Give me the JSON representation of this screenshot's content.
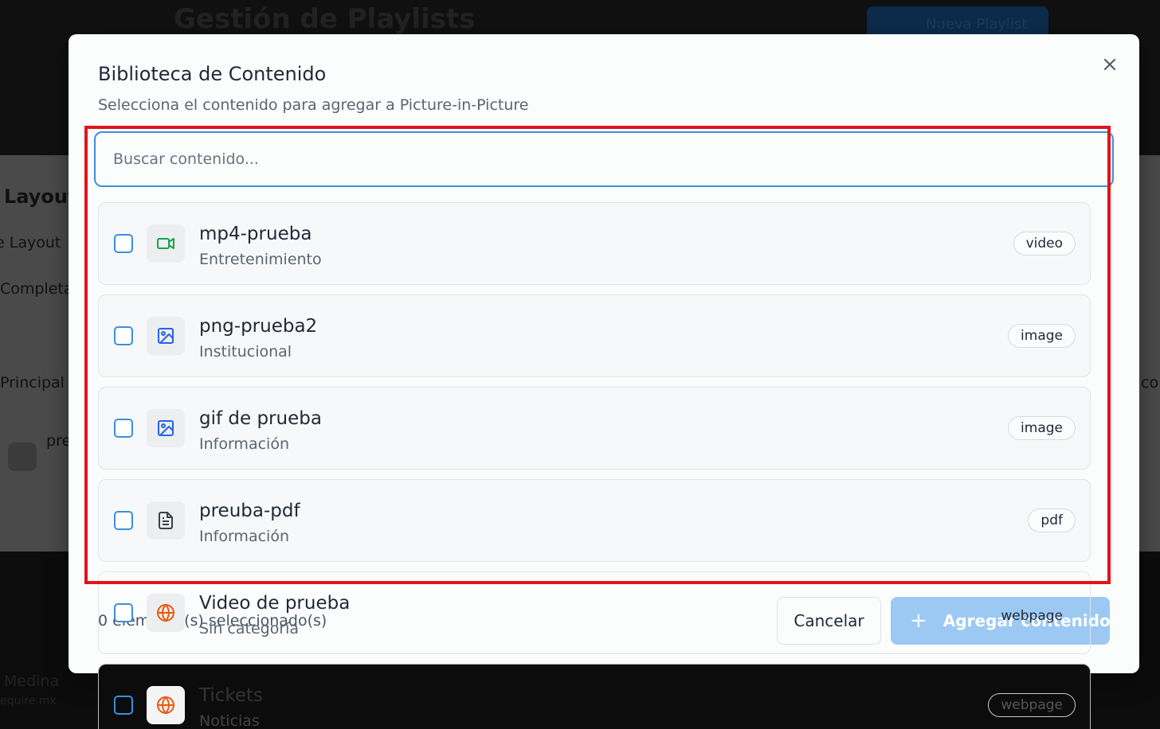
{
  "background": {
    "page_title": "Gestión de Playlists",
    "new_playlist_button": "Nueva Playlist",
    "layout_heading": "Layout",
    "layout_label": "e Layout",
    "complete_label": "Completa",
    "principal_label": "Principal",
    "content_preview": "pre",
    "right_fragment": "co",
    "user_name": "Medina",
    "user_email": "equire.mx"
  },
  "modal": {
    "title": "Biblioteca de Contenido",
    "subtitle": "Selecciona el contenido para agregar a Picture-in-Picture",
    "close_icon": "close-icon",
    "search": {
      "placeholder": "Buscar contenido...",
      "value": ""
    },
    "items": [
      {
        "name": "mp4-prueba",
        "category": "Entretenimiento",
        "type": "video",
        "icon": "video-icon",
        "icon_color": "#16a34a"
      },
      {
        "name": "png-prueba2",
        "category": "Institucional",
        "type": "image",
        "icon": "image-icon",
        "icon_color": "#2563eb"
      },
      {
        "name": "gif de prueba",
        "category": "Información",
        "type": "image",
        "icon": "image-icon",
        "icon_color": "#2563eb"
      },
      {
        "name": "preuba-pdf",
        "category": "Información",
        "type": "pdf",
        "icon": "file-text-icon",
        "icon_color": "#374151"
      },
      {
        "name": "Video de prueba",
        "category": "Sin categoría",
        "type": "webpage",
        "icon": "globe-icon",
        "icon_color": "#ea580c"
      },
      {
        "name": "Tickets",
        "category": "Noticias",
        "type": "webpage",
        "icon": "globe-icon",
        "icon_color": "#ea580c"
      }
    ],
    "footer": {
      "selected_count": "0 elemento(s) seleccionado(s)",
      "cancel_label": "Cancelar",
      "add_label": "Agregar contenido"
    }
  },
  "colors": {
    "accent": "#3b8fe0",
    "highlight": "#e0141b",
    "add_button_disabled": "#9cc9f3"
  }
}
